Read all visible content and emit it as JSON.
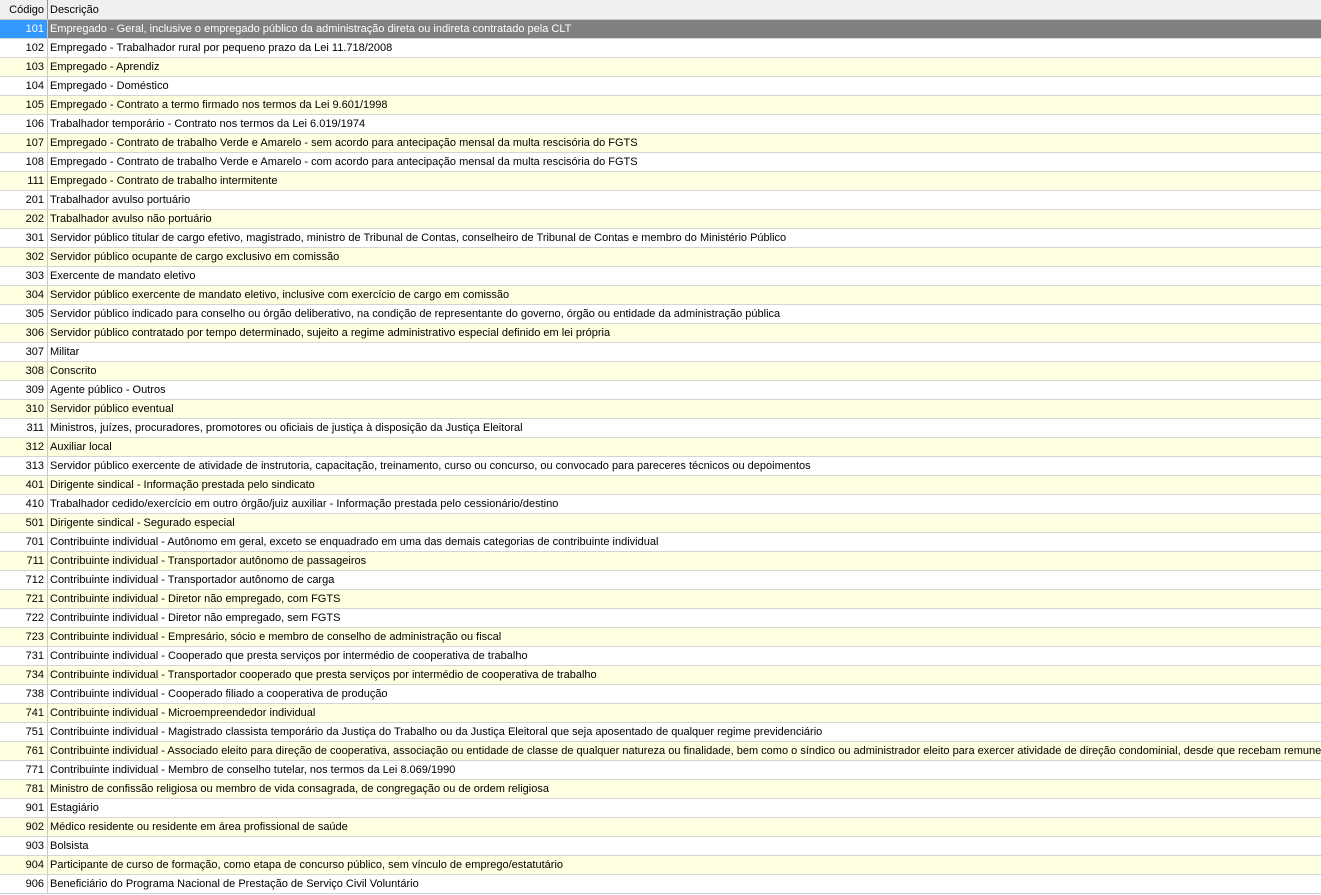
{
  "colors": {
    "selected_code": "#3399ff",
    "selected_desc": "#808080",
    "alt_row": "#ffffe1"
  },
  "columns": {
    "code": "Código",
    "description": "Descrição"
  },
  "selected_index": 0,
  "rows": [
    {
      "code": "101",
      "desc": "Empregado - Geral, inclusive o empregado público da administração direta ou indireta contratado pela CLT"
    },
    {
      "code": "102",
      "desc": "Empregado - Trabalhador rural por pequeno prazo da Lei 11.718/2008"
    },
    {
      "code": "103",
      "desc": "Empregado - Aprendiz"
    },
    {
      "code": "104",
      "desc": "Empregado - Doméstico"
    },
    {
      "code": "105",
      "desc": "Empregado - Contrato a termo firmado nos termos da Lei 9.601/1998"
    },
    {
      "code": "106",
      "desc": "Trabalhador temporário - Contrato nos termos da Lei 6.019/1974"
    },
    {
      "code": "107",
      "desc": "Empregado - Contrato de trabalho Verde e Amarelo - sem acordo para antecipação mensal da multa rescisória do FGTS"
    },
    {
      "code": "108",
      "desc": "Empregado - Contrato de trabalho Verde e Amarelo - com acordo para antecipação mensal da multa rescisória do FGTS"
    },
    {
      "code": "111",
      "desc": "Empregado - Contrato de trabalho intermitente"
    },
    {
      "code": "201",
      "desc": "Trabalhador avulso portuário"
    },
    {
      "code": "202",
      "desc": "Trabalhador avulso não portuário"
    },
    {
      "code": "301",
      "desc": "Servidor público titular de cargo efetivo, magistrado, ministro de Tribunal de Contas, conselheiro de Tribunal de Contas e membro do Ministério Público"
    },
    {
      "code": "302",
      "desc": "Servidor público ocupante de cargo exclusivo em comissão"
    },
    {
      "code": "303",
      "desc": "Exercente de mandato eletivo"
    },
    {
      "code": "304",
      "desc": "Servidor público exercente de mandato eletivo, inclusive com exercício de cargo em comissão"
    },
    {
      "code": "305",
      "desc": "Servidor público indicado para conselho ou órgão deliberativo, na condição de representante do governo, órgão ou entidade da administração pública"
    },
    {
      "code": "306",
      "desc": "Servidor público contratado por tempo determinado, sujeito a regime administrativo especial definido em lei própria"
    },
    {
      "code": "307",
      "desc": "Militar"
    },
    {
      "code": "308",
      "desc": "Conscrito"
    },
    {
      "code": "309",
      "desc": "Agente público - Outros"
    },
    {
      "code": "310",
      "desc": "Servidor público eventual"
    },
    {
      "code": "311",
      "desc": "Ministros, juízes, procuradores, promotores ou oficiais de justiça à disposição da Justiça Eleitoral"
    },
    {
      "code": "312",
      "desc": "Auxiliar local"
    },
    {
      "code": "313",
      "desc": "Servidor público exercente de atividade de instrutoria, capacitação, treinamento, curso ou concurso, ou convocado para pareceres técnicos ou depoimentos"
    },
    {
      "code": "401",
      "desc": "Dirigente sindical - Informação prestada pelo sindicato"
    },
    {
      "code": "410",
      "desc": "Trabalhador cedido/exercício em outro órgão/juiz auxiliar - Informação prestada pelo cessionário/destino"
    },
    {
      "code": "501",
      "desc": "Dirigente sindical - Segurado especial"
    },
    {
      "code": "701",
      "desc": "Contribuinte individual - Autônomo em geral, exceto se enquadrado em uma das demais categorias de contribuinte individual"
    },
    {
      "code": "711",
      "desc": "Contribuinte individual - Transportador autônomo de passageiros"
    },
    {
      "code": "712",
      "desc": "Contribuinte individual - Transportador autônomo de carga"
    },
    {
      "code": "721",
      "desc": "Contribuinte individual - Diretor não empregado, com FGTS"
    },
    {
      "code": "722",
      "desc": "Contribuinte individual - Diretor não empregado, sem FGTS"
    },
    {
      "code": "723",
      "desc": "Contribuinte individual - Empresário, sócio e membro de conselho de administração ou fiscal"
    },
    {
      "code": "731",
      "desc": "Contribuinte individual - Cooperado que presta serviços por intermédio de cooperativa de trabalho"
    },
    {
      "code": "734",
      "desc": "Contribuinte individual - Transportador cooperado que presta serviços por intermédio de cooperativa de trabalho"
    },
    {
      "code": "738",
      "desc": "Contribuinte individual - Cooperado filiado a cooperativa de produção"
    },
    {
      "code": "741",
      "desc": "Contribuinte individual - Microempreendedor individual"
    },
    {
      "code": "751",
      "desc": "Contribuinte individual - Magistrado classista temporário da Justiça do Trabalho ou da Justiça Eleitoral que seja aposentado de qualquer regime previdenciário"
    },
    {
      "code": "761",
      "desc": "Contribuinte individual - Associado eleito para direção de cooperativa, associação ou entidade de classe de qualquer natureza ou finalidade, bem como o síndico ou administrador eleito para exercer atividade de direção condominial, desde que recebam remuneração"
    },
    {
      "code": "771",
      "desc": "Contribuinte individual - Membro de conselho tutelar, nos termos da Lei 8.069/1990"
    },
    {
      "code": "781",
      "desc": "Ministro de confissão religiosa ou membro de vida consagrada, de congregação ou de ordem religiosa"
    },
    {
      "code": "901",
      "desc": "Estagiário"
    },
    {
      "code": "902",
      "desc": "Médico residente ou residente em área profissional de saúde"
    },
    {
      "code": "903",
      "desc": "Bolsista"
    },
    {
      "code": "904",
      "desc": "Participante de curso de formação, como etapa de concurso público, sem vínculo de emprego/estatutário"
    },
    {
      "code": "906",
      "desc": "Beneficiário do Programa Nacional de Prestação de Serviço Civil Voluntário"
    }
  ]
}
